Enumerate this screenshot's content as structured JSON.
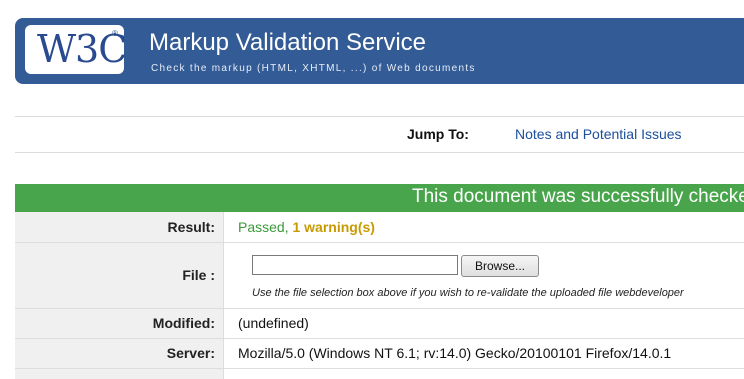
{
  "banner": {
    "logo_text": "W3C",
    "logo_reg": "®",
    "title": "Markup Validation Service",
    "subtitle": "Check the markup (HTML, XHTML, ...) of Web documents"
  },
  "jump": {
    "label": "Jump To:",
    "link": "Notes and Potential Issues"
  },
  "status": {
    "message": "This document was successfully checked"
  },
  "results": {
    "result_label": "Result:",
    "result_passed": "Passed,",
    "result_warning": "1 warning(s)",
    "file_label": "File :",
    "browse_label": "Browse...",
    "file_hint": "Use the file selection box above if you wish to re-validate the uploaded file webdeveloper",
    "modified_label": "Modified:",
    "modified_value": "(undefined)",
    "server_label": "Server:",
    "server_value": "Mozilla/5.0 (Windows NT 6.1; rv:14.0) Gecko/20100101 Firefox/14.0.1"
  },
  "colors": {
    "banner": "#335b96",
    "success": "#49a54c",
    "passed": "#3a9a3a",
    "warning": "#c79b00",
    "link": "#1b4f9c"
  }
}
